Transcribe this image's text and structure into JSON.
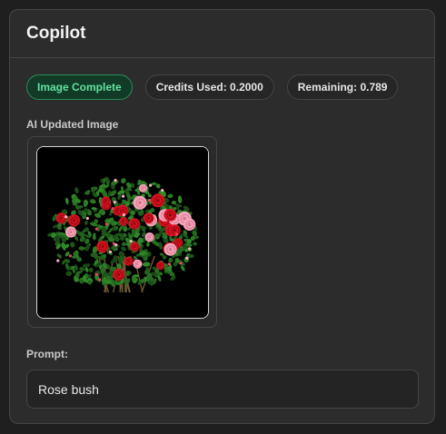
{
  "panel": {
    "title": "Copilot"
  },
  "status": {
    "complete_label": "Image Complete",
    "credits_used": "Credits Used: 0.2000",
    "remaining": "Remaining: 0.789"
  },
  "image_section": {
    "label": "AI Updated Image",
    "subject": "rose-bush-image"
  },
  "prompt": {
    "label": "Prompt:",
    "value": "Rose bush"
  },
  "colors": {
    "success_text": "#63e0a0",
    "success_bg": "#123b27",
    "panel_bg": "#2c2c2c"
  }
}
